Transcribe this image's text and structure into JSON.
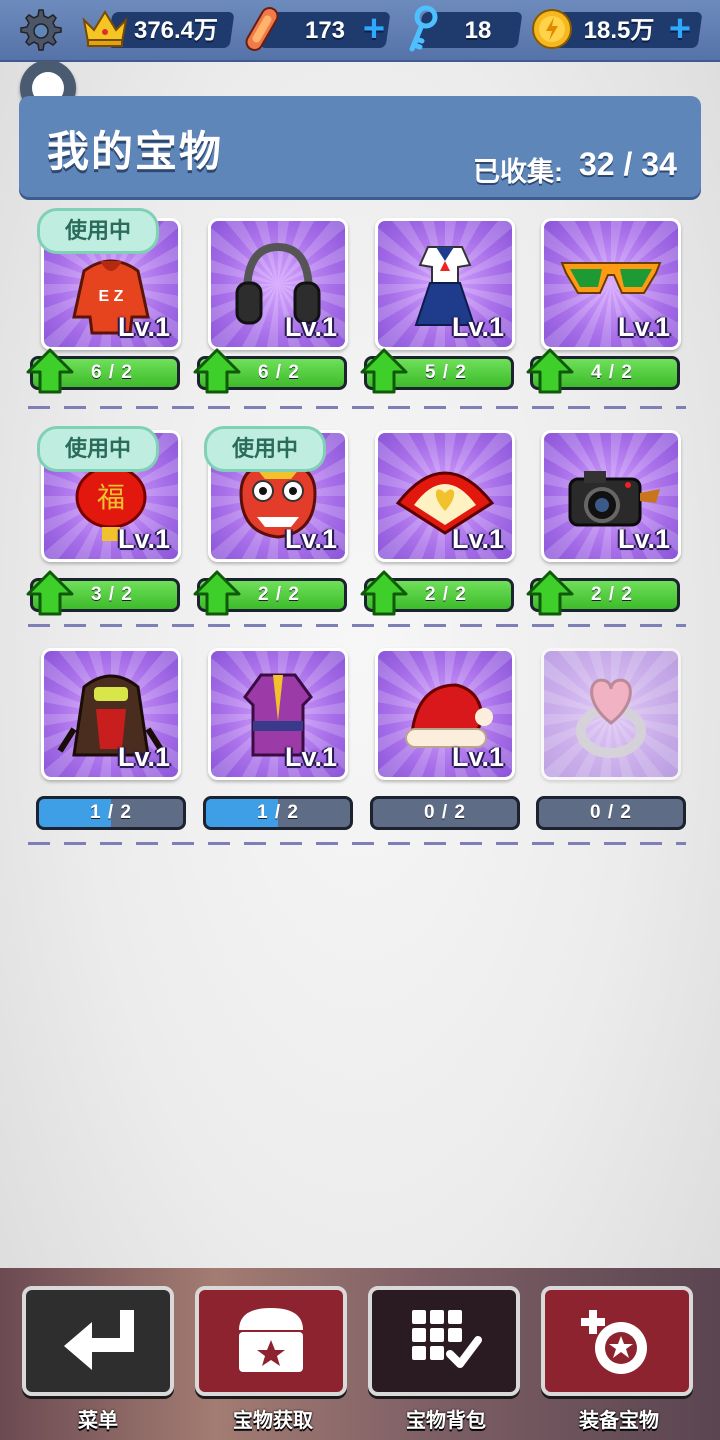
{
  "topbar": {
    "crown_value": "376.4万",
    "board_value": "173",
    "key_value": "18",
    "coin_value": "18.5万",
    "plus": "+"
  },
  "header": {
    "title": "我的宝物",
    "collected_label": "已收集:",
    "collected_value": "32 / 34"
  },
  "treasures": [
    {
      "name": "hoodie",
      "level": "Lv.1",
      "progress": "6 / 2",
      "in_use": true,
      "upgrade_ready": true
    },
    {
      "name": "headphones",
      "level": "Lv.1",
      "progress": "6 / 2",
      "in_use": false,
      "upgrade_ready": true
    },
    {
      "name": "sailor-uniform",
      "level": "Lv.1",
      "progress": "5 / 2",
      "in_use": false,
      "upgrade_ready": true
    },
    {
      "name": "sunglasses",
      "level": "Lv.1",
      "progress": "4 / 2",
      "in_use": false,
      "upgrade_ready": true
    },
    {
      "name": "lantern",
      "level": "Lv.1",
      "progress": "3 / 2",
      "in_use": true,
      "upgrade_ready": true
    },
    {
      "name": "lion-mask",
      "level": "Lv.1",
      "progress": "2 / 2",
      "in_use": true,
      "upgrade_ready": true
    },
    {
      "name": "fan",
      "level": "Lv.1",
      "progress": "2 / 2",
      "in_use": false,
      "upgrade_ready": true
    },
    {
      "name": "camera",
      "level": "Lv.1",
      "progress": "2 / 2",
      "in_use": false,
      "upgrade_ready": true
    },
    {
      "name": "hooded-jacket",
      "level": "Lv.1",
      "progress": "1 / 2",
      "in_use": false,
      "upgrade_ready": false
    },
    {
      "name": "robe",
      "level": "Lv.1",
      "progress": "1 / 2",
      "in_use": false,
      "upgrade_ready": false
    },
    {
      "name": "santa-hat",
      "level": "Lv.1",
      "progress": "0 / 2",
      "in_use": false,
      "upgrade_ready": false
    },
    {
      "name": "heart-ring",
      "level": "",
      "progress": "0 / 2",
      "in_use": false,
      "upgrade_ready": false
    }
  ],
  "in_use_label": "使用中",
  "nav": {
    "menu": "菜单",
    "get_treasure": "宝物获取",
    "treasure_bag": "宝物背包",
    "equip_treasure": "装备宝物"
  },
  "colors": {
    "header_bg": "#5f86b8",
    "card_purple": "#a76ee8",
    "progress_green": "#3dbb2a",
    "progress_blue": "#3e9ee6",
    "progress_gray": "#5e6d85",
    "nav_red": "#8e2330",
    "nav_dark": "#2e2e2e"
  },
  "icons": [
    "gear-icon",
    "crown-icon",
    "skateboard-icon",
    "key-icon",
    "coin-icon",
    "back-arrow-icon",
    "chest-icon",
    "grid-check-icon",
    "equip-icon"
  ]
}
